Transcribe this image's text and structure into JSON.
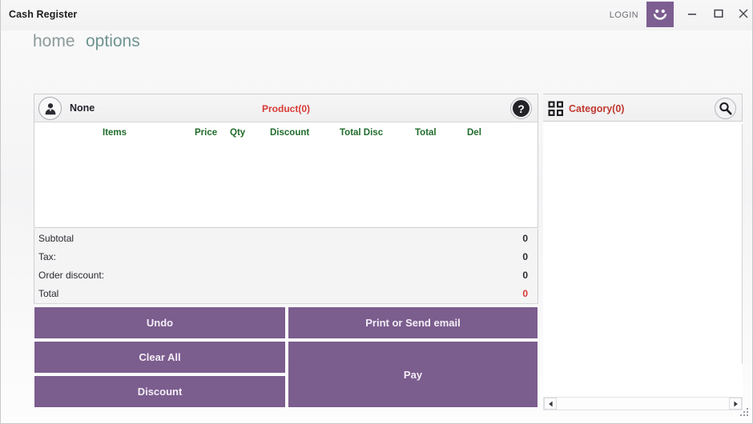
{
  "window": {
    "title": "Cash Register",
    "login_label": "LOGIN",
    "avatar_icon": "smiley-face-icon",
    "minimize_icon": "minimize-icon",
    "maximize_icon": "maximize-icon",
    "close_icon": "close-icon"
  },
  "nav": {
    "items": [
      {
        "label": "home",
        "color": "#8c9a99"
      },
      {
        "label": "options",
        "color": "#6f9491"
      }
    ]
  },
  "order": {
    "customer": "None",
    "customer_icon": "person-icon",
    "product_count_label": "Product(0)",
    "help_icon": "question-mark-icon",
    "columns": [
      "Items",
      "Price",
      "Qty",
      "Discount",
      "Total Disc",
      "Total",
      "Del"
    ],
    "rows": [],
    "column_color": "#1f6b2a",
    "accent_red": "#d73a34"
  },
  "totals": {
    "rows": [
      {
        "label": "Subtotal",
        "value": "0"
      },
      {
        "label": "Tax:",
        "value": "0"
      },
      {
        "label": "Order discount:",
        "value": "0"
      },
      {
        "label": "Total",
        "value": "0"
      }
    ]
  },
  "actions": {
    "undo": "Undo",
    "clear_all": "Clear All",
    "discount": "Discount",
    "print_or_send_email": "Print or Send email",
    "pay": "Pay",
    "button_color": "#7b5d8e"
  },
  "category": {
    "grid_icon": "grid-squares-icon",
    "count_label": "Category(0)",
    "search_icon": "search-icon",
    "items": [],
    "accent_red": "#c0392f"
  },
  "scrollbar": {
    "left_arrow_icon": "arrow-left-icon",
    "right_arrow_icon": "arrow-right-icon"
  },
  "resize_grip_icon": "resize-grip-icon"
}
